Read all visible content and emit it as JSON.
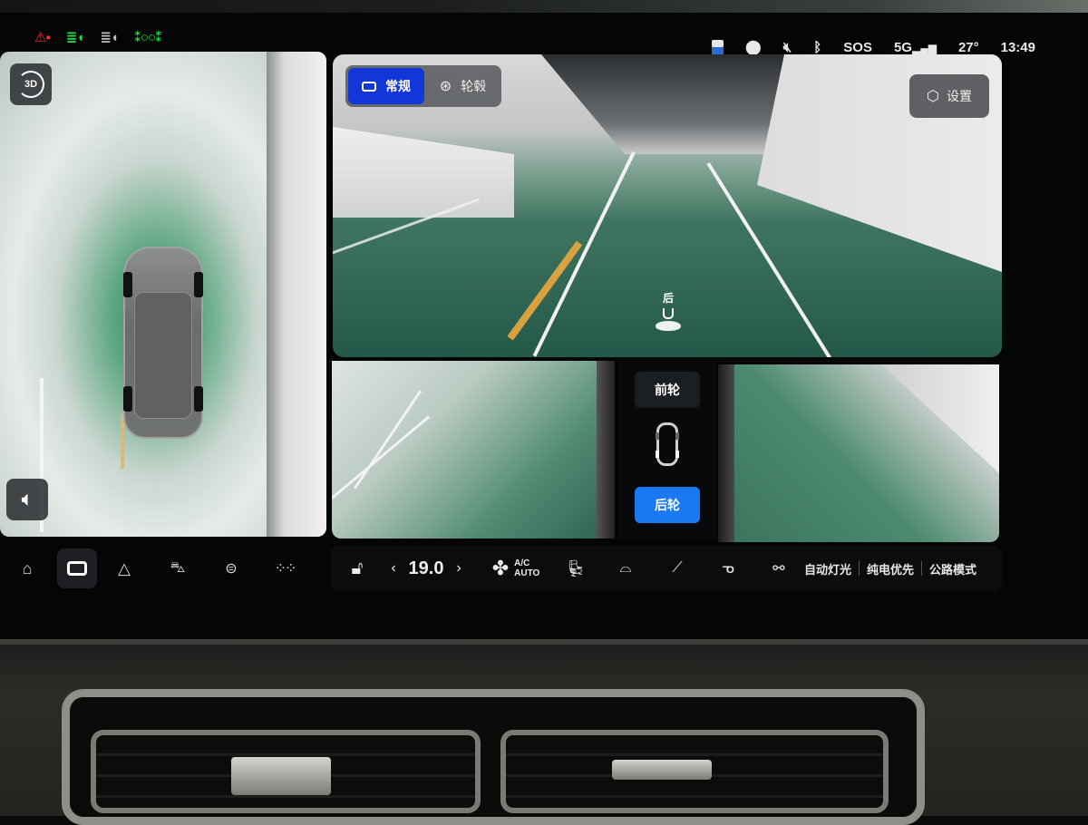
{
  "status_bar": {
    "indicators": [
      {
        "name": "seatbelt-warning-icon",
        "glyph": "⚠",
        "color": "#ff2a2a"
      },
      {
        "name": "auto-high-beam-icon",
        "glyph": "≣◖",
        "color": "#22e03a"
      },
      {
        "name": "headlight-auto-icon",
        "glyph": "≣◖",
        "color": "#bdbdbd"
      },
      {
        "name": "position-lights-icon",
        "glyph": "⁑◎⁑",
        "color": "#22e03a"
      }
    ],
    "sos": "SOS",
    "network": "5G",
    "temperature": "27°",
    "time": "13:49"
  },
  "overview": {
    "view_3d_label": "3D"
  },
  "camera": {
    "modes": [
      {
        "label": "常规",
        "active": true
      },
      {
        "label": "轮毂",
        "active": false
      }
    ],
    "settings_label": "设置",
    "rear_marker_label": "后"
  },
  "wheel_selector": {
    "front_label": "前轮",
    "rear_label": "后轮",
    "selected": "rear",
    "accent": "#1a78f2"
  },
  "bottom_nav": {
    "items": [
      {
        "name": "home",
        "active": false
      },
      {
        "name": "camera",
        "active": true
      },
      {
        "name": "navigation",
        "active": false
      },
      {
        "name": "vehicle",
        "active": false
      },
      {
        "name": "controls",
        "active": false
      },
      {
        "name": "apps",
        "active": false
      }
    ]
  },
  "climate": {
    "temperature": "19.0",
    "ac_label": "A/C",
    "auto_label": "AUTO",
    "modes": [
      "自动灯光",
      "纯电优先",
      "公路模式"
    ]
  }
}
